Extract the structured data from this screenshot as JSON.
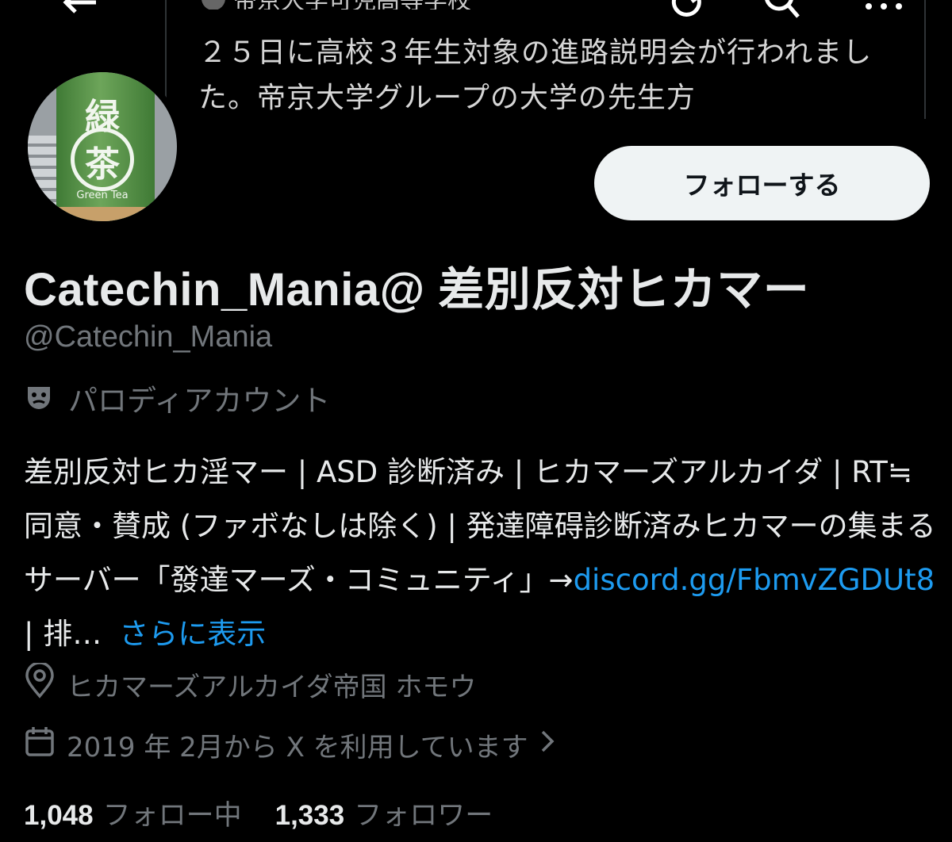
{
  "banner": {
    "author_fragment": "帝京大学可児高等学校",
    "tweet_text": "２５日に高校３年生対象の進路説明会が行われました。帝京大学グループの大学の先生方"
  },
  "avatar": {
    "kanji_top": "緑",
    "kanji_center": "茶",
    "label": "Green Tea"
  },
  "profile": {
    "follow_button": "フォローする",
    "display_name": "Catechin_Mania@ 差別反対ヒカマー",
    "handle": "@Catechin_Mania",
    "parody_label": "パロディアカウント",
    "bio_text": "差別反対ヒカ淫マー | ASD 診断済み | ヒカマーズアルカイダ | RT≒同意・賛成 (ファボなしは除く) | 発達障碍診断済みヒカマーの集まるサーバー「發達マーズ・コミュニティ」→",
    "bio_link": "discord.gg/FbmvZGDUt8",
    "bio_tail": " | 排…",
    "show_more": "さらに表示",
    "location": "ヒカマーズアルカイダ帝国 ホモウ",
    "joined": "2019 年 2月から X を利用しています",
    "following_count": "1,048",
    "following_label": "フォロー中",
    "followers_count": "1,333",
    "followers_label": "フォロワー"
  },
  "icons": [
    "back-arrow-icon",
    "refresh-icon",
    "search-icon",
    "more-icon",
    "theater-mask-icon",
    "location-pin-icon",
    "calendar-icon",
    "chevron-right-icon"
  ],
  "colors": {
    "background": "#000000",
    "text": "#e7e9ea",
    "muted": "#71767b",
    "link": "#1d9bf0",
    "button_bg": "#eff3f4"
  }
}
